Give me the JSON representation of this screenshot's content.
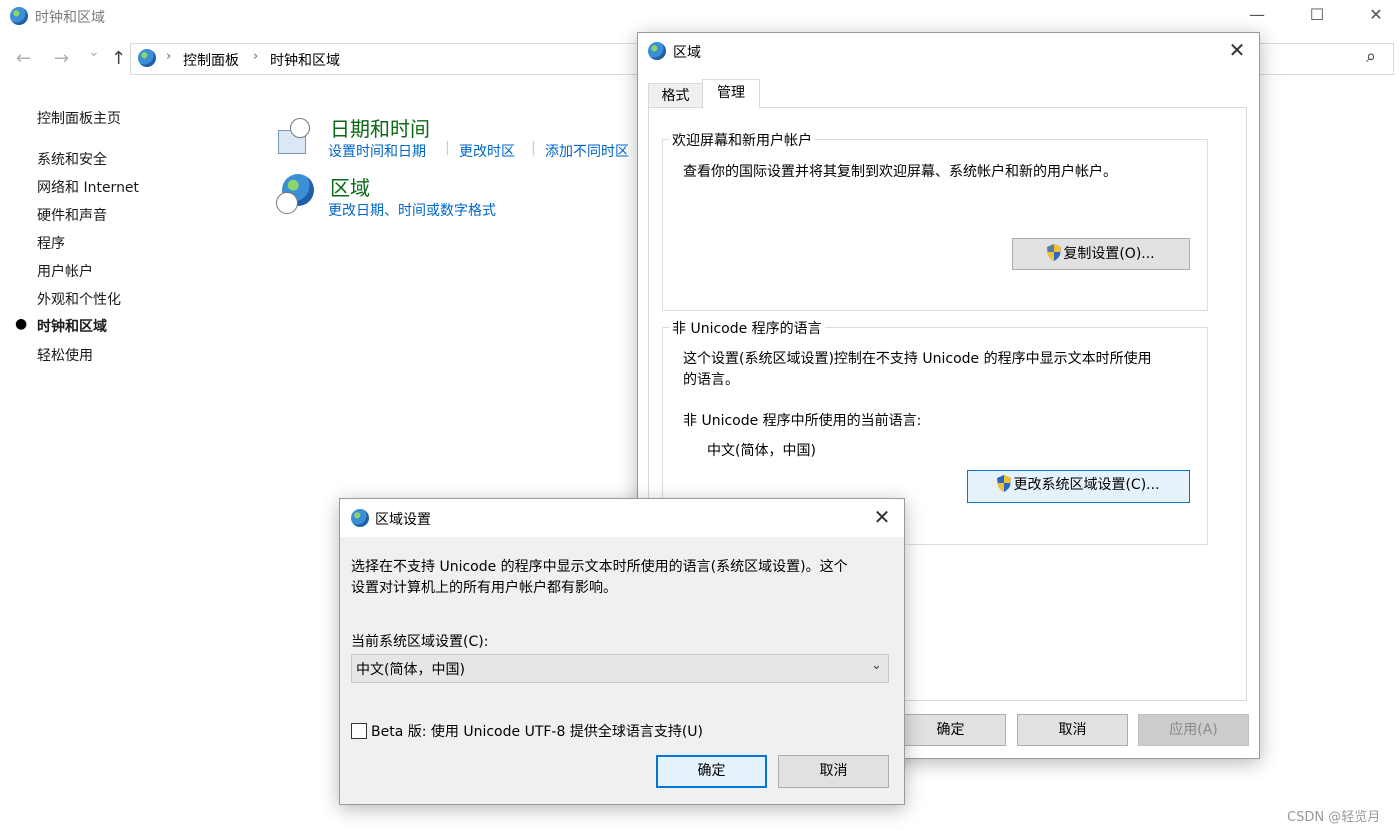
{
  "window": {
    "title": "时钟和区域",
    "minimize_icon": "—",
    "maximize_icon": "☐",
    "close_icon": "✕"
  },
  "nav": {
    "back": "←",
    "forward": "→",
    "recent": "⌄",
    "up": "↑",
    "breadcrumbs": [
      "控制面板",
      "时钟和区域"
    ],
    "search_icon": "⌕"
  },
  "sidebar": {
    "home": "控制面板主页",
    "items": [
      {
        "label": "系统和安全"
      },
      {
        "label": "网络和 Internet"
      },
      {
        "label": "硬件和声音"
      },
      {
        "label": "程序"
      },
      {
        "label": "用户帐户"
      },
      {
        "label": "外观和个性化"
      },
      {
        "label": "时钟和区域",
        "active": true
      },
      {
        "label": "轻松使用"
      }
    ]
  },
  "categories": [
    {
      "title": "日期和时间",
      "links": [
        "设置时间和日期",
        "更改时区",
        "添加不同时区"
      ]
    },
    {
      "title": "区域",
      "links": [
        "更改日期、时间或数字格式"
      ]
    }
  ],
  "region_dialog": {
    "title": "区域",
    "tabs": [
      "格式",
      "管理"
    ],
    "active_tab": "管理",
    "welcome_group": {
      "label": "欢迎屏幕和新用户帐户",
      "text": "查看你的国际设置并将其复制到欢迎屏幕、系统帐户和新的用户帐户。",
      "button": "复制设置(O)..."
    },
    "unicode_group": {
      "label": "非 Unicode 程序的语言",
      "text_line1": "这个设置(系统区域设置)控制在不支持 Unicode 的程序中显示文本时所使用",
      "text_line2": "的语言。",
      "current_label": "非 Unicode 程序中所使用的当前语言:",
      "current_value": "中文(简体，中国)",
      "button": "更改系统区域设置(C)..."
    },
    "ok": "确定",
    "cancel": "取消",
    "apply": "应用(A)"
  },
  "locale_dialog": {
    "title": "区域设置",
    "desc_line1": "选择在不支持 Unicode 的程序中显示文本时所使用的语言(系统区域设置)。这个",
    "desc_line2": "设置对计算机上的所有用户帐户都有影响。",
    "select_label": "当前系统区域设置(C):",
    "select_value": "中文(简体，中国)",
    "beta_label": "Beta 版: 使用 Unicode UTF-8 提供全球语言支持(U)",
    "beta_checked": false,
    "ok": "确定",
    "cancel": "取消"
  },
  "watermark": "CSDN @轻览月",
  "colors": {
    "accent": "#0078d7",
    "category_title": "#0b6a15",
    "link": "#0066cc"
  }
}
